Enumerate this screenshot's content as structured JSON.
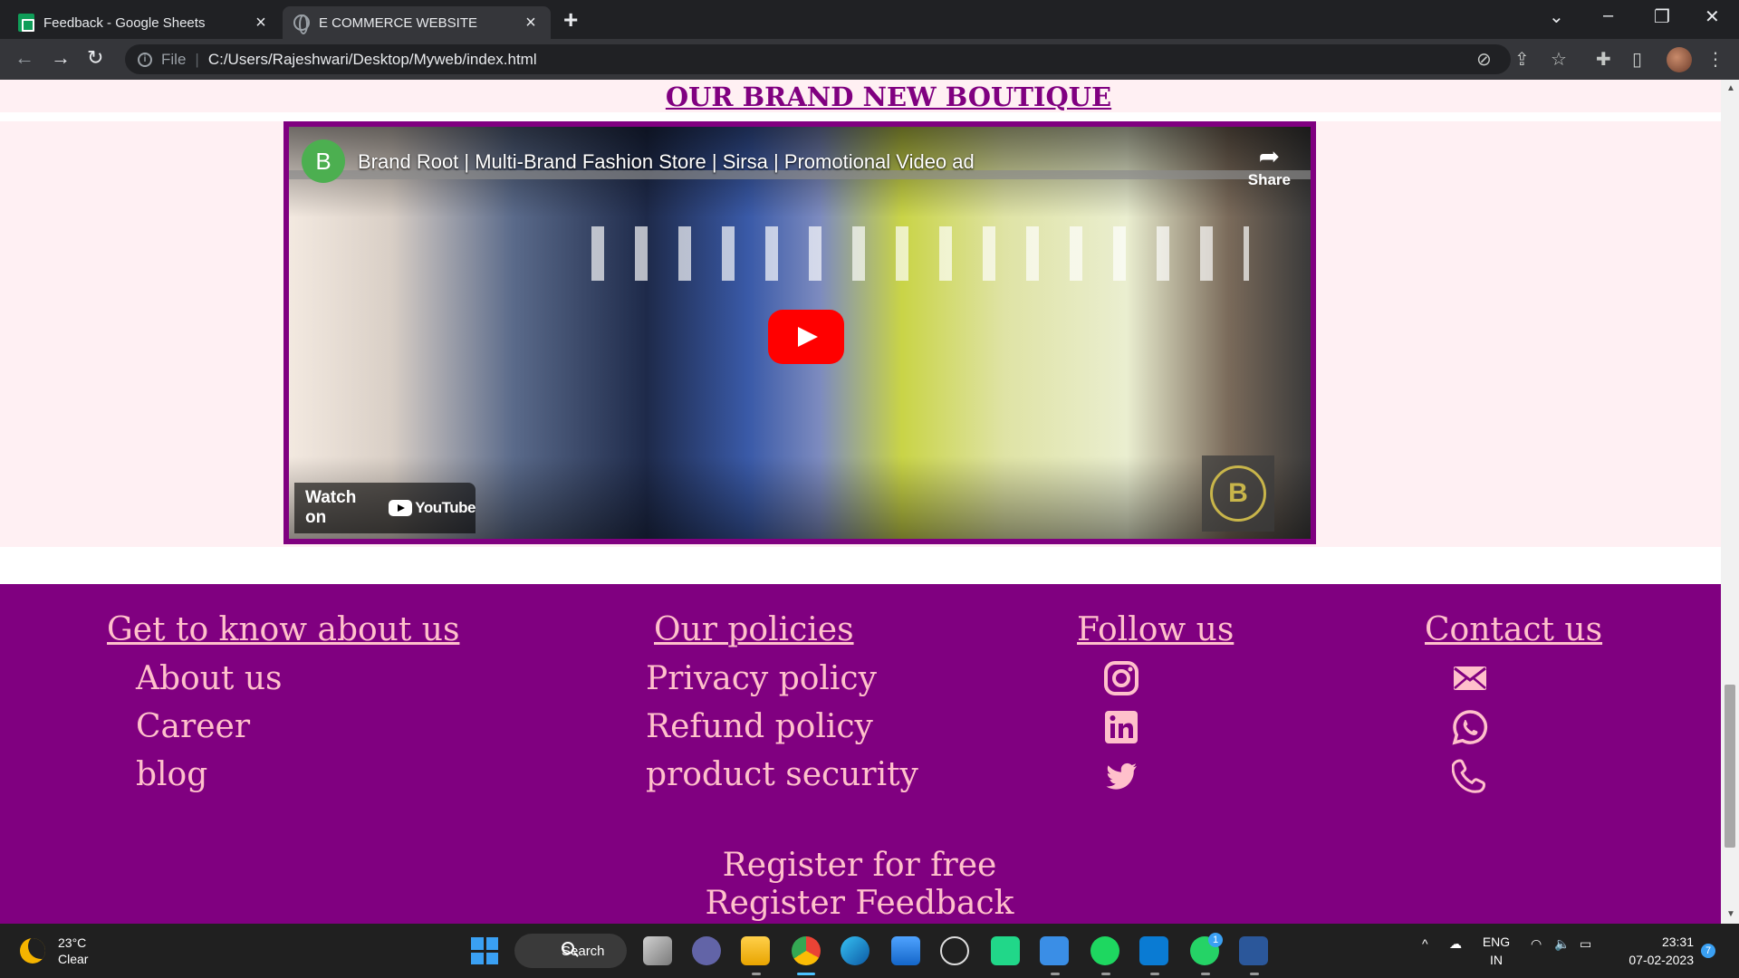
{
  "browser": {
    "tabs": [
      {
        "label": "Feedback - Google Sheets",
        "icon": "google-sheets-icon"
      },
      {
        "label": "E COMMERCE WEBSITE",
        "icon": "globe-icon"
      }
    ],
    "address": {
      "scheme_label": "File",
      "url": "C:/Users/Rajeshwari/Desktop/Myweb/index.html"
    }
  },
  "page": {
    "section_title": "OUR BRAND NEW BOUTIQUE",
    "video": {
      "channel_initial": "B",
      "title": "Brand Root | Multi-Brand Fashion Store | Sirsa | Promotional Video ad",
      "share_label": "Share",
      "watch_on_label": "Watch on",
      "youtube_label": "YouTube",
      "watermark_letter": "B"
    },
    "footer": {
      "columns": [
        {
          "heading": "Get to know about us",
          "links": [
            "About us",
            "Career",
            "blog"
          ]
        },
        {
          "heading": "Our policies",
          "links": [
            "Privacy policy",
            "Refund policy",
            "product security"
          ]
        },
        {
          "heading": "Follow us",
          "icons": [
            "instagram-icon",
            "linkedin-icon",
            "twitter-icon"
          ]
        },
        {
          "heading": "Contact us",
          "icons": [
            "mail-icon",
            "whatsapp-icon",
            "phone-icon"
          ]
        }
      ],
      "register_link": "Register for free",
      "feedback_link": "Register Feedback"
    },
    "colors": {
      "brand_purple": "#800080",
      "link_pink": "#ffc0cb",
      "section_bg": "#fff0f3"
    }
  },
  "taskbar": {
    "weather_temp": "23°C",
    "weather_desc": "Clear",
    "search_label": "Search",
    "whatsapp_badge": "1",
    "language": "ENG",
    "region": "IN",
    "time": "23:31",
    "date": "07-02-2023",
    "notification_count": "7"
  }
}
